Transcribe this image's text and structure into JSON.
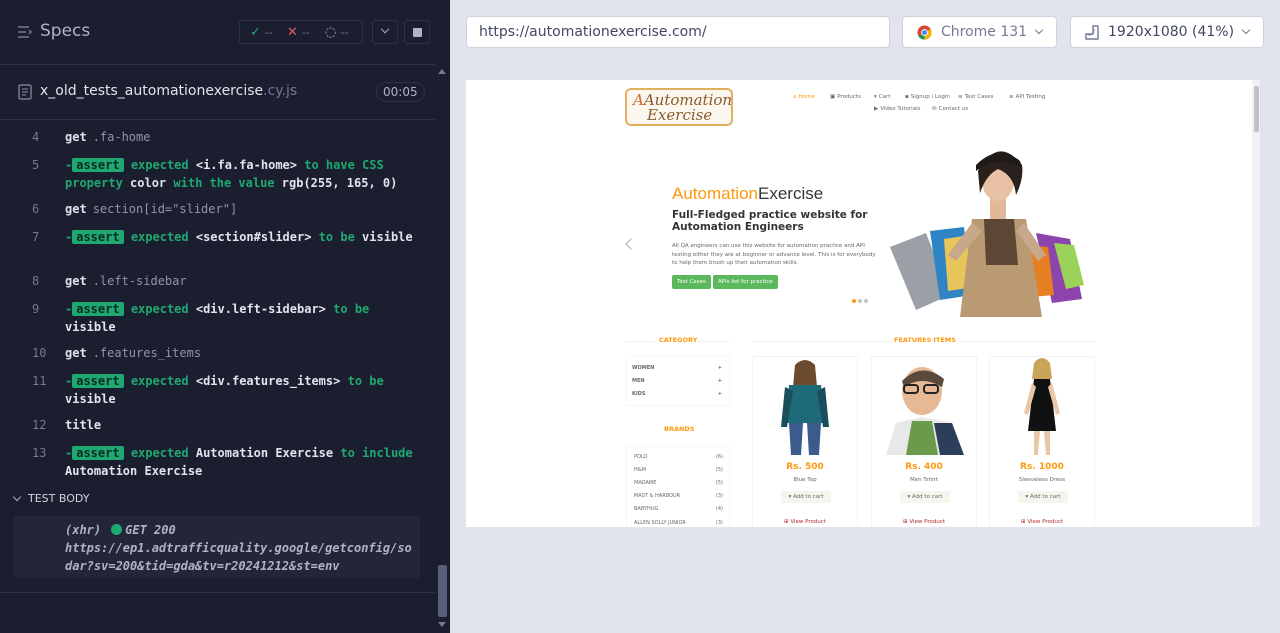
{
  "specs": {
    "title": "Specs",
    "stats": {
      "passed": "--",
      "failed": "--",
      "pending": "--"
    },
    "file_name": "x_old_tests_automationexercise",
    "file_ext": ".cy.js",
    "timer": "00:05"
  },
  "commands": [
    {
      "num": "4",
      "kind": "get",
      "keyword": "get",
      "selector": ".fa-home"
    },
    {
      "num": "5",
      "kind": "assert",
      "parts": [
        "expected",
        "<i.fa.fa-home>",
        "to have CSS property",
        "color",
        "with the value",
        "rgb(255, 165, 0)"
      ]
    },
    {
      "num": "6",
      "kind": "get",
      "keyword": "get",
      "selector": "section[id=\"slider\"]"
    },
    {
      "num": "7",
      "kind": "assert",
      "parts": [
        "expected",
        "<section#slider>",
        "to be",
        "visible"
      ]
    },
    {
      "num": "8",
      "kind": "get",
      "keyword": "get",
      "selector": ".left-sidebar"
    },
    {
      "num": "9",
      "kind": "assert",
      "parts": [
        "expected",
        "<div.left-sidebar>",
        "to be",
        "visible"
      ]
    },
    {
      "num": "10",
      "kind": "get",
      "keyword": "get",
      "selector": ".features_items"
    },
    {
      "num": "11",
      "kind": "assert",
      "parts": [
        "expected",
        "<div.features_items>",
        "to be",
        "visible"
      ]
    },
    {
      "num": "12",
      "kind": "get",
      "keyword": "title",
      "selector": ""
    },
    {
      "num": "13",
      "kind": "assert",
      "parts": [
        "expected",
        "Automation Exercise",
        "to",
        "include",
        "Automation Exercise"
      ]
    }
  ],
  "assert_badge": "assert",
  "test_body": {
    "label": "TEST BODY",
    "xhr_label": "(xhr)",
    "xhr_status": "GET 200",
    "xhr_url_line1": "https://ep1.adtrafficquality.google/getconfig/so",
    "xhr_url_line2": "dar?sv=200&tid=gda&tv=r20241212&st=env"
  },
  "toolbar": {
    "url": "https://automationexercise.com/",
    "browser": "Chrome 131",
    "viewport": "1920x1080 (41%)"
  },
  "site": {
    "logo_line1": "Automation",
    "logo_line2": "Exercise",
    "nav": [
      "Home",
      "Products",
      "Cart",
      "Signup / Login",
      "Test Cases",
      "API Testing",
      "Video Tutorials",
      "Contact us"
    ],
    "slider": {
      "title_a": "Automation",
      "title_b": "Exercise",
      "heading": "Full-Fledged practice website for Automation Engineers",
      "text": "All QA engineers can use this website for automation practice and API testing either they are at beginner or advance level. This is for everybody to help them brush up their automation skills.",
      "btn1": "Test Cases",
      "btn2": "APIs list for practice"
    },
    "category_title": "CATEGORY",
    "categories": [
      "WOMEN",
      "MEN",
      "KIDS"
    ],
    "brands_title": "BRANDS",
    "brands": [
      {
        "name": "POLO",
        "count": "(6)"
      },
      {
        "name": "H&M",
        "count": "(5)"
      },
      {
        "name": "MADAME",
        "count": "(5)"
      },
      {
        "name": "MAST & HARBOUR",
        "count": "(3)"
      },
      {
        "name": "BABYHUG",
        "count": "(4)"
      },
      {
        "name": "ALLEN SOLLY JUNIOR",
        "count": "(3)"
      }
    ],
    "features_title": "FEATURES ITEMS",
    "products": [
      {
        "price": "Rs. 500",
        "name": "Blue Top",
        "cart": "Add to cart",
        "view": "View Product"
      },
      {
        "price": "Rs. 400",
        "name": "Men Tshirt",
        "cart": "Add to cart",
        "view": "View Product"
      },
      {
        "price": "Rs. 1000",
        "name": "Sleeveless Dress",
        "cart": "Add to cart",
        "view": "View Product"
      }
    ]
  },
  "colors": {
    "panel_bg": "#1b1e2e",
    "green": "#1fa971",
    "red": "#e45770",
    "orange": "#fe980f"
  }
}
